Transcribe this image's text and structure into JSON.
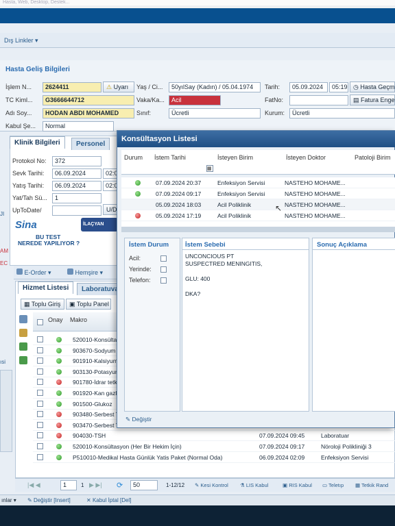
{
  "top_strip": {
    "text": "Hasta, Web, Desktop, Destek..."
  },
  "links": {
    "label": "Dış Linkler ▾"
  },
  "patient": {
    "section_title": "Hasta Geliş Bilgileri",
    "islem_label": "İşlem N...",
    "islem_no": "2624411",
    "uyari": "Uyarı",
    "yas_label": "Yaş / Ci...",
    "yas_value": "50yılSay (Kadın) / 05.04.1974",
    "tarih_label": "Tarih:",
    "tarih_value": "05.09.2024",
    "saat_value": "05:19",
    "hasta_gecmis": "Hasta Geçm",
    "tc_label": "TC Kiml...",
    "tc_value": "G3666644712",
    "vaka_label": "Vaka/Ka...",
    "vaka_value": "Acil",
    "fatno_label": "FatNo:",
    "fatura_btn": "Fatura Enge",
    "adi_label": "Adı Soy...",
    "adi_value": "HODAN ABDI MOHAMED",
    "sinif_label": "Sınıf:",
    "sinif_value": "Ücretli",
    "kurum_label": "Kurum:",
    "kurum_value": "Ücretli",
    "kabul_label": "Kabul Şe...",
    "kabul_value": "Normal"
  },
  "clinic": {
    "tab_active": "Klinik Bilgileri",
    "tab_other": "Personel",
    "protokol_label": "Protokol No:",
    "protokol_value": "372",
    "sevk_label": "Sevk Tarihi:",
    "sevk_value": "06.09.2024",
    "sevk_time": "02:0",
    "yatis_label": "Yatış Tarihi:",
    "yatis_value": "06.09.2024",
    "yatis_time": "02:0",
    "yattah_label": "Yat/Tah Sü...",
    "yattah_value": "1",
    "uptodate_label": "UpToDate/",
    "ud_btn": "U/D",
    "sina_logo": "Sina",
    "bu_test_1": "BU TEST",
    "bu_test_2": "NEREDE YAPILIYOR ?",
    "ilacyan_logo": "İLAÇYAN"
  },
  "side_codes": [
    "JI",
    "AM",
    "EC",
    "ısi"
  ],
  "order_bar": {
    "eorder": "E-Order ▾",
    "hemsire": "Hemşire ▾"
  },
  "service_tabs": {
    "active": "Hizmet Listesi",
    "other": "Laboratuvar"
  },
  "service_buttons": {
    "toplu_giris": "Toplu Giriş",
    "toplu_panel": "Toplu Panel"
  },
  "service_table": {
    "headers": {
      "onay": "Onay",
      "makro": "Makro"
    },
    "rows": [
      {
        "status": "green",
        "code": "520010-Konsültasy"
      },
      {
        "status": "green",
        "code": "903670-Sodyum (N"
      },
      {
        "status": "green",
        "code": "901910-Kalsiyum ("
      },
      {
        "status": "green",
        "code": "903130-Potasyum"
      },
      {
        "status": "red",
        "code": "901780-İdrar tetkik"
      },
      {
        "status": "green",
        "code": "901920-Kan gazlar"
      },
      {
        "status": "green",
        "code": "901500-Glukoz"
      },
      {
        "status": "red",
        "code": "903480-Serbest T4"
      },
      {
        "status": "red",
        "code": "903470-Serbest T3"
      },
      {
        "status": "red",
        "code": "904030-TSH",
        "date": "07.09.2024 09:45",
        "dept": "Laboratuar"
      },
      {
        "status": "green",
        "code": "520010-Konsültasyon (Her Bir Hekim İçin)",
        "date": "07.09.2024 09:17",
        "dept": "Nöroloji Polikliniği 3"
      },
      {
        "status": "green",
        "code": "P510010-Medikal Hasta Günlük Yatis Paket (Normal Oda)",
        "date": "06.09.2024 02:09",
        "dept": "Enfeksiyon Servisi"
      }
    ]
  },
  "pager": {
    "page": "1",
    "of": "1",
    "page_size": "50",
    "range": "1-12/12",
    "kesi": "Kesi Kontrol",
    "lis": "LIS Kabul",
    "ris": "RIS Kabul",
    "teletip": "Teletıp",
    "tetkik": "Tetkik Rand"
  },
  "bottom_bar": {
    "left": "ınlar ▾",
    "degistir": "Değiştir [Insert]",
    "kabul_iptal": "Kabul İptal [Del]"
  },
  "consult_dialog": {
    "title": "Konsültasyon Listesi",
    "headers": {
      "durum": "Durum",
      "istem_tarihi": "İstem Tarihi",
      "isteyen_birim": "İsteyen Birim",
      "isteyen_doktor": "İsteyen Doktor",
      "patoloji_birim": "Patoloji Birim"
    },
    "rows": [
      {
        "status": "green",
        "date": "07.09.2024 20:37",
        "birim": "Enfeksiyon Servisi",
        "doktor": "NASTEHO MOHAME..."
      },
      {
        "status": "green",
        "date": "07.09.2024 09:17",
        "birim": "Enfeksiyon Servisi",
        "doktor": "NASTEHO MOHAME..."
      },
      {
        "status": "none",
        "date": "05.09.2024 18:03",
        "birim": "Acil Poliklinik",
        "doktor": "NASTEHO MOHAME..."
      },
      {
        "status": "red",
        "date": "05.09.2024 17:19",
        "birim": "Acil Poliklinik",
        "doktor": "NASTEHO MOHAME..."
      }
    ],
    "istem_durum": {
      "title": "İstem Durum",
      "acil": "Acil:",
      "yerinde": "Yerinde:",
      "telefon": "Telefon:"
    },
    "istem_sebebi": {
      "title": "İstem Sebebi",
      "lines": [
        "UNCONCIOUS  PT",
        "SUSPECTRED MENINGITIS,",
        "",
        "GLU: 400",
        "",
        "DKA?"
      ]
    },
    "sonuc": {
      "title": "Sonuç Açıklama"
    },
    "degistir": "Değiştir"
  }
}
